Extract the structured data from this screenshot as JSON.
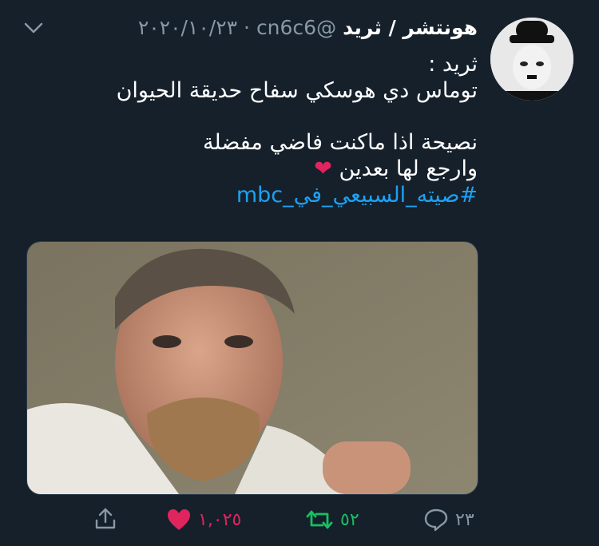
{
  "tweet": {
    "author_name": "هونتشر / ثريد",
    "handle_time": "@cn6c6 · ٢٠٢٠/١٠/٢٣",
    "lines": [
      "ثريد :",
      "توماس دي هوسكي سفاح حديقة الحيوان",
      "نصيحة اذا ماكنت فاضي مفضلة",
      "وارجع لها بعدين"
    ],
    "heart_emoji": "❤",
    "hashtag": "#صيته_السبيعي_في_mbc"
  },
  "actions": {
    "reply_count": "٢٣",
    "retweet_count": "٥٢",
    "like_count": "١,٠٢٥"
  },
  "colors": {
    "background": "#15202b",
    "muted": "#8899a6",
    "link": "#1da1f2",
    "retweet_active": "#17bf63",
    "like_active": "#e0245e"
  },
  "icons": [
    "chevron-down-icon",
    "reply-icon",
    "retweet-icon",
    "like-icon",
    "share-icon"
  ]
}
